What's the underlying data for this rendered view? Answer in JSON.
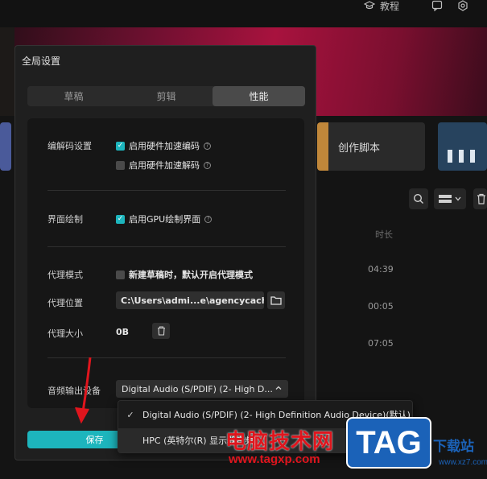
{
  "header": {
    "tutorial_label": "教程"
  },
  "cards": {
    "script_label": "创作脚本"
  },
  "list": {
    "time_header": "时长",
    "rows": [
      {
        "duration": "04:39"
      },
      {
        "duration": "00:05"
      },
      {
        "duration": "07:05"
      }
    ]
  },
  "dialog": {
    "title": "全局设置",
    "tabs": [
      {
        "label": "草稿"
      },
      {
        "label": "剪辑"
      },
      {
        "label": "性能"
      }
    ],
    "active_tab": "性能",
    "codec": {
      "label": "编解码设置",
      "hw_encode": {
        "label": "启用硬件加速编码",
        "checked": true
      },
      "hw_decode": {
        "label": "启用硬件加速解码",
        "checked": false
      }
    },
    "render": {
      "label": "界面绘制",
      "gpu": {
        "label": "启用GPU绘制界面",
        "checked": true
      }
    },
    "proxy": {
      "mode_label": "代理模式",
      "mode_option": {
        "label": "新建草稿时，默认开启代理模式",
        "checked": false
      },
      "location_label": "代理位置",
      "location_value": "C:\\Users\\admi...e\\agencycache",
      "size_label": "代理大小",
      "size_value": "0B"
    },
    "audio": {
      "label": "音频输出设备",
      "selected": "Digital Audio (S/PDIF) (2- High D...",
      "options": [
        {
          "label": "Digital Audio (S/PDIF) (2- High Definition Audio Device)(默认)",
          "selected": true
        },
        {
          "label": "HPC (英特尔(R) 显示器音频)",
          "selected": false
        }
      ]
    },
    "save_label": "保存"
  },
  "watermark": {
    "cn_text": "电脑技术网",
    "url": "www.tagxp.com",
    "tag": "TAG",
    "site_label": "下载站",
    "site_url": "www.xz7.com"
  },
  "colors": {
    "accent": "#1db5bd",
    "dialog_bg": "#1f1f1f",
    "panel_bg": "#161616",
    "watermark_red": "#e0151d",
    "watermark_blue": "#1b62b8"
  }
}
